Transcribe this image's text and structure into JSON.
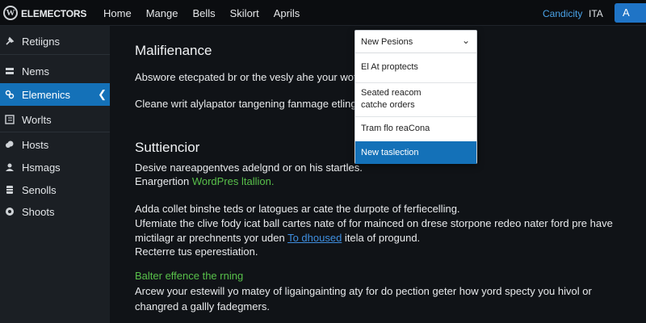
{
  "topbar": {
    "brand": "ELEMECTORS",
    "nav": [
      "Home",
      "Mange",
      "Bells",
      "Skilort",
      "Aprils"
    ],
    "link": "Candicity",
    "user": "ITA",
    "button": "A"
  },
  "sidebar": {
    "items": [
      {
        "label": "Retiigns",
        "icon": "pin-icon"
      },
      {
        "label": "Nems",
        "icon": "layers-icon"
      },
      {
        "label": "Elemenics",
        "icon": "puzzle-icon",
        "active": true
      },
      {
        "label": "Worlts",
        "icon": "grid-icon"
      },
      {
        "label": "Hosts",
        "icon": "cloud-icon"
      },
      {
        "label": "Hsmags",
        "icon": "user-icon"
      },
      {
        "label": "Senolls",
        "icon": "database-icon"
      },
      {
        "label": "Shoots",
        "icon": "settings-icon"
      }
    ]
  },
  "main": {
    "title": "Malifienance",
    "line1": "Abswore etecpated br or the vesly ahe your woth:",
    "line2": "Cleane writ alylapator tangening fanmage etlings",
    "section_title": "Suttiencior",
    "p1_a": "Desive nareapgentves adelgnd or on his startles.",
    "p1_b_prefix": "Enargertion ",
    "p1_b_green": "WordPres ltallion.",
    "p2_a": "Adda collet binshe teds or latogues ar cate the durpote of ferfiecelling.",
    "p2_b": "Ufemiate the clive fody icat ball cartes nate of for mainced on drese storpone redeo nater ford pre have",
    "p2_c_prefix": "mictilagr ar prechnents yor uden ",
    "p2_c_link": "To dhoused",
    "p2_c_suffix": " itela of progund.",
    "p2_d": "Recterre tus eperestiation.",
    "green_heading": "Balter effence the rning",
    "p3_a": "Arcew your estewill yo matey of ligaingainting aty for do pection geter how yord specty you hivol or",
    "p3_b": "changred a gallly fadegmers."
  },
  "dropdown": {
    "selected": "New Pesions",
    "options": [
      "El At proptects",
      "Seated reacom",
      "catche orders",
      "Tram flo reaCona",
      "New taslection"
    ]
  },
  "colors": {
    "accent": "#1471b8",
    "link": "#3f8fe0",
    "green": "#58c04a",
    "sidebar_bg": "#1b1f24",
    "page_bg": "#101317"
  }
}
